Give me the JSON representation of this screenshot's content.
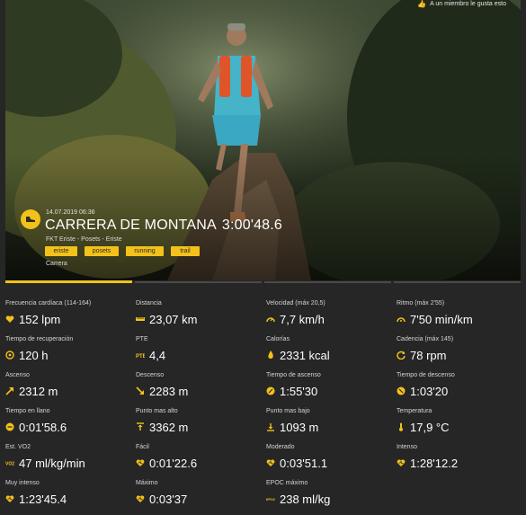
{
  "header": {
    "likes_text": "A un miembro le gusta esto"
  },
  "activity": {
    "date": "14.07.2019 06:36",
    "title": "CARRERA DE MONTANA",
    "duration": "3:00'48.6",
    "location": "FKT Eriste - Posets - Eriste",
    "tags": [
      "eriste",
      "posets",
      "running",
      "trail"
    ],
    "sport": "Carrera"
  },
  "colors": {
    "accent": "#f2c21a",
    "background": "#262626",
    "text": "#ffffff"
  },
  "stats": [
    {
      "label": "Frecuencia cardíaca  (114-164)",
      "value": "152 lpm",
      "icon": "heart-icon"
    },
    {
      "label": "Distancia",
      "value": "23,07 km",
      "icon": "ruler-icon"
    },
    {
      "label": "Velocidad  (máx  20,5)",
      "value": "7,7 km/h",
      "icon": "speedometer-icon"
    },
    {
      "label": "Ritmo  (máx  2'55)",
      "value": "7'50 min/km",
      "icon": "pace-icon"
    },
    {
      "label": "Tiempo de recuperación",
      "value": "120 h",
      "icon": "recovery-icon"
    },
    {
      "label": "PTE",
      "value": "4,4",
      "icon": "pte-icon"
    },
    {
      "label": "Calorías",
      "value": "2331 kcal",
      "icon": "flame-icon"
    },
    {
      "label": "Cadencia  (máx  145)",
      "value": "78 rpm",
      "icon": "cadence-icon"
    },
    {
      "label": "Ascenso",
      "value": "2312 m",
      "icon": "ascent-arrow-icon"
    },
    {
      "label": "Descenso",
      "value": "2283 m",
      "icon": "descent-arrow-icon"
    },
    {
      "label": "Tiempo de ascenso",
      "value": "1:55'30",
      "icon": "ascent-time-icon"
    },
    {
      "label": "Tiempo de descenso",
      "value": "1:03'20",
      "icon": "descent-time-icon"
    },
    {
      "label": "Tiempo en llano",
      "value": "0:01'58.6",
      "icon": "flat-time-icon"
    },
    {
      "label": "Punto mas alto",
      "value": "3362 m",
      "icon": "highest-point-icon"
    },
    {
      "label": "Punto mas bajo",
      "value": "1093 m",
      "icon": "lowest-point-icon"
    },
    {
      "label": "Temperatura",
      "value": "17,9 °C",
      "icon": "thermometer-icon"
    },
    {
      "label": "Est. VO2",
      "value": "47 ml/kg/min",
      "icon": "vo2-icon"
    },
    {
      "label": "Fácil",
      "value": "0:01'22.6",
      "icon": "heart-easy-icon"
    },
    {
      "label": "Moderado",
      "value": "0:03'51.1",
      "icon": "heart-moderate-icon"
    },
    {
      "label": "Intenso",
      "value": "1:28'12.2",
      "icon": "heart-intense-icon"
    },
    {
      "label": "Muy intenso",
      "value": "1:23'45.4",
      "icon": "heart-very-intense-icon"
    },
    {
      "label": "Máximo",
      "value": "0:03'37",
      "icon": "heart-max-icon"
    },
    {
      "label": "EPOC máximo",
      "value": "238 ml/kg",
      "icon": "epoc-icon"
    }
  ]
}
